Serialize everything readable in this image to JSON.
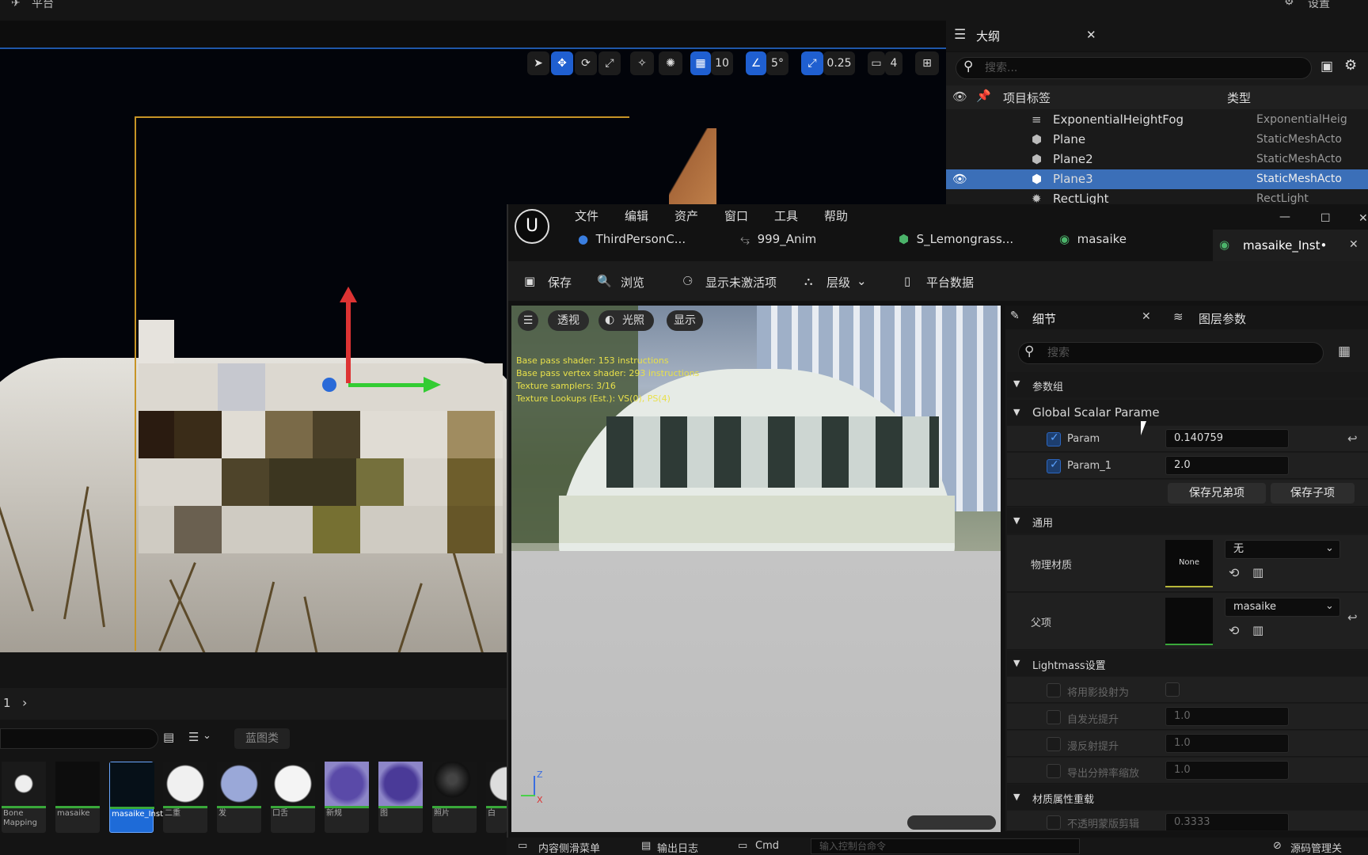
{
  "top": {
    "left_label": "平台",
    "right_label": "设置"
  },
  "viewport_toolbar": {
    "grid": "10",
    "angle": "5°",
    "scale": "0.25",
    "camera": "4"
  },
  "outliner": {
    "title": "大纲",
    "search_placeholder": "搜索...",
    "col_label": "项目标签",
    "col_type": "类型",
    "rows": [
      {
        "name": "ExponentialHeightFog",
        "type": "ExponentialHeig"
      },
      {
        "name": "Plane",
        "type": "StaticMeshActo"
      },
      {
        "name": "Plane2",
        "type": "StaticMeshActo"
      },
      {
        "name": "Plane3",
        "type": "StaticMeshActo"
      },
      {
        "name": "RectLight",
        "type": "RectLight"
      }
    ]
  },
  "content_browser": {
    "page": "1",
    "filter_chip": "蓝图类",
    "assets": [
      "Bone Mapping",
      "masaike",
      "masaike_Inst",
      "二重",
      "发",
      "口舌",
      "新规",
      "图",
      "照片",
      "白"
    ]
  },
  "material_editor": {
    "menu": [
      "文件",
      "编辑",
      "资产",
      "窗口",
      "工具",
      "帮助"
    ],
    "tabs": [
      "ThirdPersonC...",
      "999_Anim",
      "S_Lemongrass...",
      "masaike",
      "masaike_Inst•"
    ],
    "toolbar": {
      "save": "保存",
      "browse": "浏览",
      "show_inactive": "显示未激活项",
      "hierarchy": "层级",
      "platform": "平台数据"
    },
    "preview": {
      "view": "透视",
      "lit": "光照",
      "show": "显示",
      "stats": [
        "Base pass shader: 153 instructions",
        "Base pass vertex shader: 293 instructions",
        "Texture samplers: 3/16",
        "Texture Lookups (Est.): VS(0), PS(4)"
      ]
    },
    "details": {
      "tab_details": "细节",
      "tab_layers": "图层参数",
      "search_placeholder": "搜索",
      "group_params": "参数组",
      "group_scalar": "Global Scalar Parame",
      "params": [
        {
          "name": "Param",
          "value": "0.140759"
        },
        {
          "name": "Param_1",
          "value": "2.0"
        }
      ],
      "save_siblings": "保存兄弟项",
      "save_children": "保存子项",
      "group_general": "通用",
      "phys_mat_label": "物理材质",
      "phys_mat_thumb": "None",
      "phys_mat_value": "无",
      "parent_label": "父项",
      "parent_value": "masaike",
      "group_lightmass": "Lightmass设置",
      "lightmass": [
        {
          "name": "将用影投射为",
          "value": ""
        },
        {
          "name": "自发光提升",
          "value": "1.0"
        },
        {
          "name": "漫反射提升",
          "value": "1.0"
        },
        {
          "name": "导出分辨率缩放",
          "value": "1.0"
        }
      ],
      "group_override": "材质属性重载",
      "override_row": {
        "name": "不透明蒙版剪辑",
        "value": "0.3333"
      }
    },
    "status": {
      "drawer": "内容侧滑菜单",
      "log": "输出日志",
      "cmd": "Cmd",
      "cmd_placeholder": "输入控制台命令",
      "source": "源码管理关"
    }
  }
}
